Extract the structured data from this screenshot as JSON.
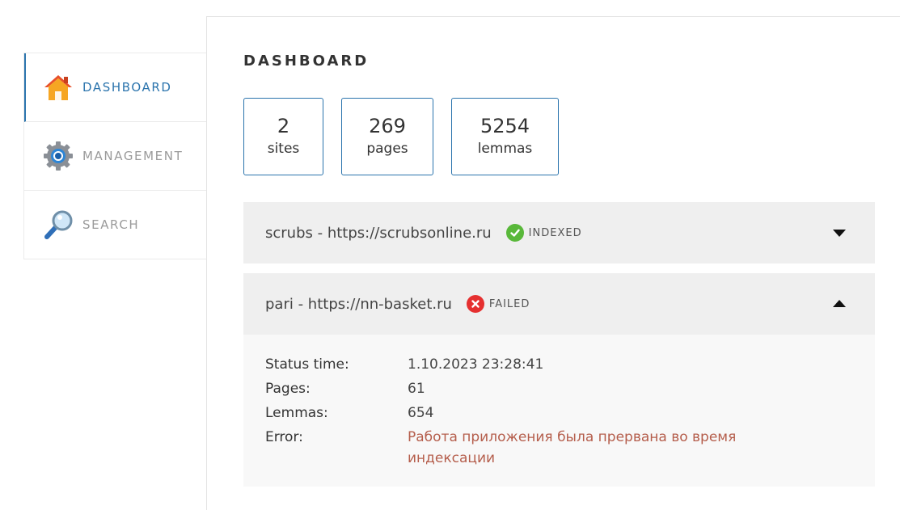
{
  "nav": {
    "items": [
      {
        "label": "DASHBOARD",
        "icon": "home-icon",
        "active": true
      },
      {
        "label": "MANAGEMENT",
        "icon": "gear-icon",
        "active": false
      },
      {
        "label": "SEARCH",
        "icon": "magnifier-icon",
        "active": false
      }
    ]
  },
  "page": {
    "title": "DASHBOARD"
  },
  "stats": [
    {
      "value": "2",
      "label": "sites"
    },
    {
      "value": "269",
      "label": "pages"
    },
    {
      "value": "5254",
      "label": "lemmas"
    }
  ],
  "sites": [
    {
      "name": "scrubs - https://scrubsonline.ru",
      "status": "INDEXED",
      "status_icon": "check-icon",
      "status_color": "#59b83a",
      "expanded": false
    },
    {
      "name": "pari - https://nn-basket.ru",
      "status": "FAILED",
      "status_icon": "x-icon",
      "status_color": "#e53030",
      "expanded": true,
      "details": {
        "status_time_label": "Status time:",
        "status_time": "1.10.2023 23:28:41",
        "pages_label": "Pages:",
        "pages": "61",
        "lemmas_label": "Lemmas:",
        "lemmas": "654",
        "error_label": "Error:",
        "error": "Работа приложения была прервана во время индексации"
      }
    }
  ],
  "colors": {
    "accent": "#2b74ad",
    "error_text": "#b55e4c"
  }
}
